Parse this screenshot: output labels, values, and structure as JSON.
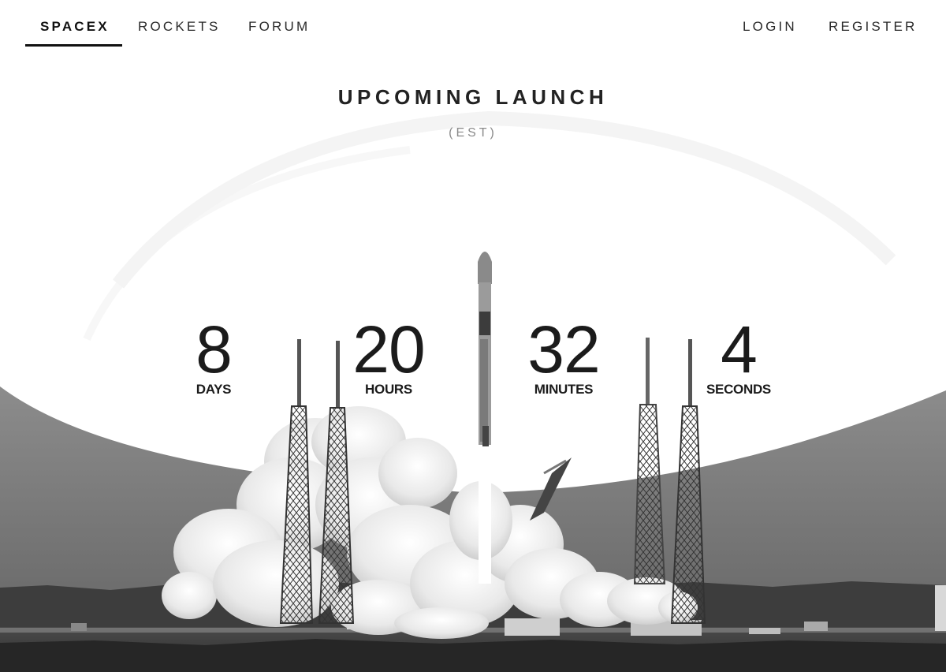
{
  "nav": {
    "left": [
      {
        "label": "SPACEX",
        "active": true
      },
      {
        "label": "ROCKETS",
        "active": false
      },
      {
        "label": "FORUM",
        "active": false
      }
    ],
    "right": [
      {
        "label": "LOGIN"
      },
      {
        "label": "REGISTER"
      }
    ]
  },
  "hero": {
    "title": "UPCOMING LAUNCH",
    "timezone": "(EST)"
  },
  "countdown": [
    {
      "value": "8",
      "label": "DAYS"
    },
    {
      "value": "20",
      "label": "HOURS"
    },
    {
      "value": "32",
      "label": "MINUTES"
    },
    {
      "value": "4",
      "label": "SECONDS"
    }
  ],
  "colors": {
    "text": "#1e1e1e",
    "muted": "#8a8a8a",
    "background": "#ffffff",
    "sky": "#7a7a7a"
  }
}
